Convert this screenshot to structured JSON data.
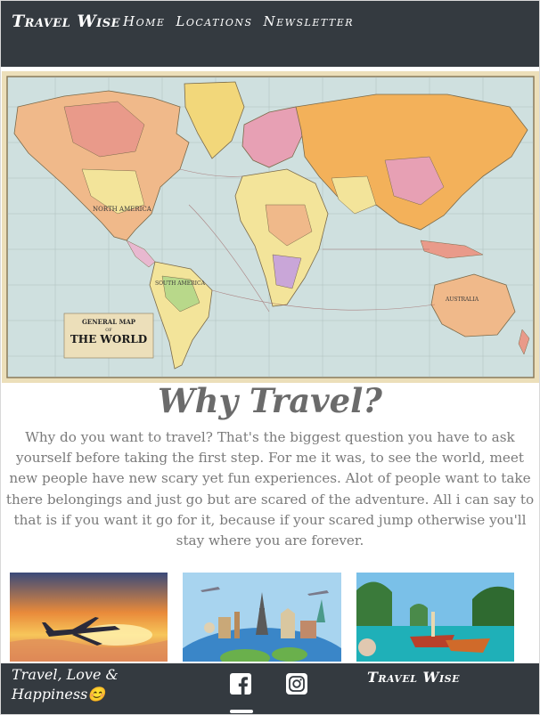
{
  "header": {
    "brand": "Travel Wise",
    "nav": [
      "Home",
      "Locations",
      "Newsletter"
    ]
  },
  "hero": {
    "map_label_top": "GENERAL MAP",
    "map_label_of": "OF",
    "map_label_main": "THE WORLD",
    "map_labels": {
      "north_america": "NORTH AMERICA",
      "south_america": "SOUTH AMERICA",
      "australia": "AUSTRALIA"
    }
  },
  "section": {
    "title": "Why Travel?",
    "body": "Why do you want to travel? That's the biggest question you have to ask yourself before taking the first step. For me it was, to see the world, meet new people have new scary yet fun experiences. Alot of people want to take there belongings and just go but are scared of the adventure. All i can say to that is if you want it go for it, because if your scared jump otherwise you'll stay where you are forever."
  },
  "footer": {
    "tagline": "Travel, Love & Happiness😊",
    "brand": "Travel Wise",
    "social_icons": [
      "facebook-icon",
      "instagram-icon"
    ]
  },
  "colors": {
    "header_bg": "#343a40",
    "text_gray": "#7a7a7a",
    "title_gray": "#6b6b6b"
  }
}
